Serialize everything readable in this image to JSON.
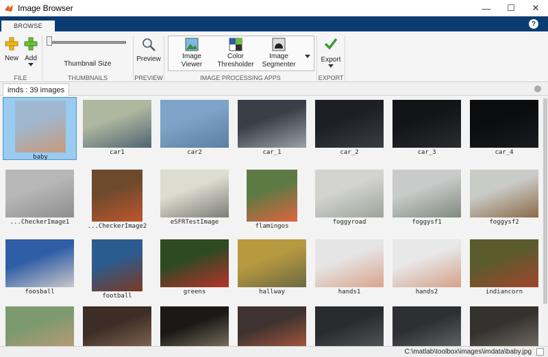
{
  "window": {
    "title": "Image Browser"
  },
  "tabs": {
    "browse": "BROWSE"
  },
  "ribbon": {
    "file": {
      "new": "New",
      "add": "Add",
      "section": "FILE"
    },
    "thumbnails": {
      "label": "Thumbnail Size",
      "section": "THUMBNAILS"
    },
    "preview": {
      "label": "Preview",
      "section": "PREVIEW"
    },
    "apps": {
      "section": "IMAGE PROCESSING APPS",
      "viewer_1": "Image",
      "viewer_2": "Viewer",
      "thresholder_1": "Color",
      "thresholder_2": "Thresholder",
      "segmenter_1": "Image",
      "segmenter_2": "Segmenter"
    },
    "export": {
      "label": "Export",
      "section": "EXPORT"
    }
  },
  "document": {
    "tab": "imds : 39 images"
  },
  "gallery": {
    "items": [
      {
        "name": "baby",
        "colors": [
          "#9fb7cf",
          "#c99a7b"
        ],
        "selected": true
      },
      {
        "name": "car1",
        "colors": [
          "#aeb7a0",
          "#4e6470"
        ]
      },
      {
        "name": "car2",
        "colors": [
          "#7ea3c8",
          "#5b7fa2"
        ]
      },
      {
        "name": "car_1",
        "colors": [
          "#3a3f47",
          "#9aa0a8"
        ]
      },
      {
        "name": "car_2",
        "colors": [
          "#1c1f24",
          "#3a3d42"
        ]
      },
      {
        "name": "car_3",
        "colors": [
          "#121417",
          "#2a2c30"
        ]
      },
      {
        "name": "car_4",
        "colors": [
          "#0b0c0e",
          "#1b1c1f"
        ]
      },
      {
        "name": "...CheckerImage1",
        "colors": [
          "#b7b7b7",
          "#8e8e8e"
        ]
      },
      {
        "name": "...CheckerImage2",
        "colors": [
          "#6e4a2d",
          "#c0562e"
        ]
      },
      {
        "name": "eSFRTestImage",
        "colors": [
          "#dcdcd0",
          "#7d7d78"
        ]
      },
      {
        "name": "flamingos",
        "colors": [
          "#5d7a44",
          "#e0643f"
        ]
      },
      {
        "name": "foggyroad",
        "colors": [
          "#d3d3d0",
          "#9ea59a"
        ]
      },
      {
        "name": "foggysf1",
        "colors": [
          "#c8cbc9",
          "#7f8a7e"
        ]
      },
      {
        "name": "foggysf2",
        "colors": [
          "#c9cbc7",
          "#8b6a46"
        ]
      },
      {
        "name": "foosball",
        "colors": [
          "#2f5da6",
          "#c9c9c9"
        ]
      },
      {
        "name": "football",
        "colors": [
          "#2b5c8f",
          "#7a3a22"
        ]
      },
      {
        "name": "greens",
        "colors": [
          "#2d4a23",
          "#b7322a"
        ]
      },
      {
        "name": "hallway",
        "colors": [
          "#b79a3f",
          "#6d6a43"
        ]
      },
      {
        "name": "hands1",
        "colors": [
          "#e5e5e5",
          "#d8a48d"
        ]
      },
      {
        "name": "hands2",
        "colors": [
          "#e8e8e8",
          "#d4a08a"
        ]
      },
      {
        "name": "indiancorn",
        "colors": [
          "#5b5b2e",
          "#a0452b"
        ]
      },
      {
        "name": "",
        "colors": [
          "#7c9a6e",
          "#c49a77"
        ]
      },
      {
        "name": "",
        "colors": [
          "#3d2d26",
          "#8a6e5a"
        ]
      },
      {
        "name": "",
        "colors": [
          "#1a1917",
          "#8a7f66"
        ]
      },
      {
        "name": "",
        "colors": [
          "#3e3330",
          "#b85c3e"
        ]
      },
      {
        "name": "",
        "colors": [
          "#2a2b2e",
          "#5a5b5e"
        ]
      },
      {
        "name": "",
        "colors": [
          "#2d2f33",
          "#6a6c70"
        ]
      },
      {
        "name": "",
        "colors": [
          "#34322f",
          "#7a746a"
        ]
      }
    ]
  },
  "status": {
    "path": "C:\\matlab\\toolbox\\images\\imdata\\baby.jpg"
  }
}
